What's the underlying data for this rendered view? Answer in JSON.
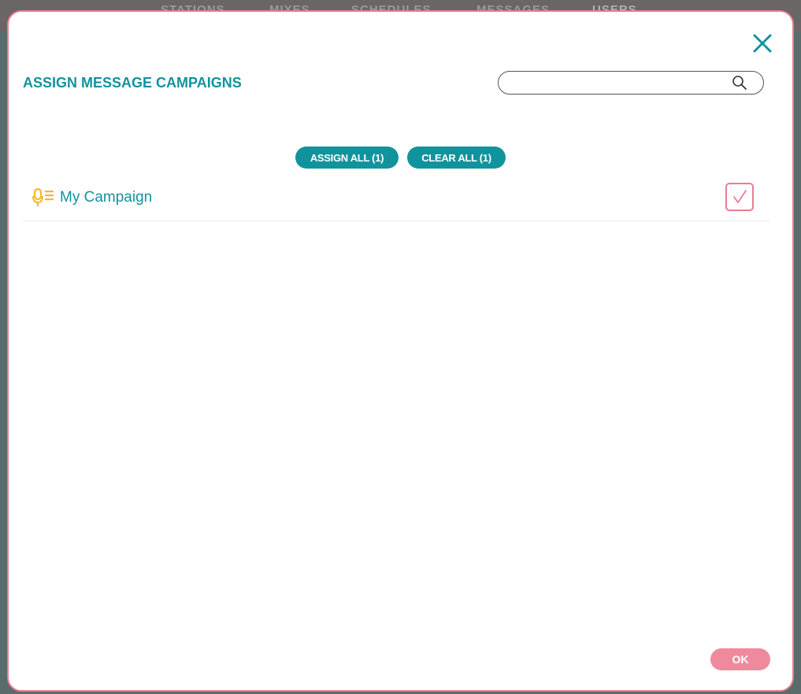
{
  "background_nav": {
    "items": [
      "STATIONS",
      "MIXES",
      "SCHEDULES",
      "MESSAGES",
      "USERS"
    ]
  },
  "modal": {
    "title": "ASSIGN MESSAGE CAMPAIGNS",
    "search": {
      "value": "",
      "placeholder": ""
    },
    "assign_all_label": "ASSIGN ALL (1)",
    "clear_all_label": "CLEAR ALL (1)",
    "campaigns": [
      {
        "name": "My Campaign",
        "icon": "microphone-list-icon",
        "checked": true
      }
    ],
    "ok_label": "OK"
  },
  "colors": {
    "accent_teal": "#11939e",
    "accent_pink": "#e97d92",
    "ok_pink": "#ef8a9c",
    "campaign_icon_yellow": "#f5b82e"
  }
}
